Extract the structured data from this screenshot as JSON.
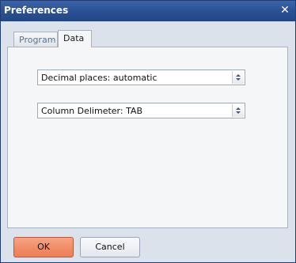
{
  "window": {
    "title": "Preferences",
    "close_glyph": "✕",
    "icons": {
      "close": "close-icon",
      "spinner": "up-down-arrows-icon"
    }
  },
  "tabs": [
    {
      "label": "Program",
      "active": false
    },
    {
      "label": "Data",
      "active": true
    }
  ],
  "fields": {
    "decimal_places": {
      "value": "Decimal places: automatic"
    },
    "column_delimiter": {
      "value": "Column Delimeter: TAB"
    }
  },
  "buttons": {
    "ok_label": "OK",
    "cancel_label": "Cancel"
  },
  "colors": {
    "titlebar": "#2a4f93",
    "ok_button": "#f08a64",
    "panel": "#f5f6f8"
  }
}
